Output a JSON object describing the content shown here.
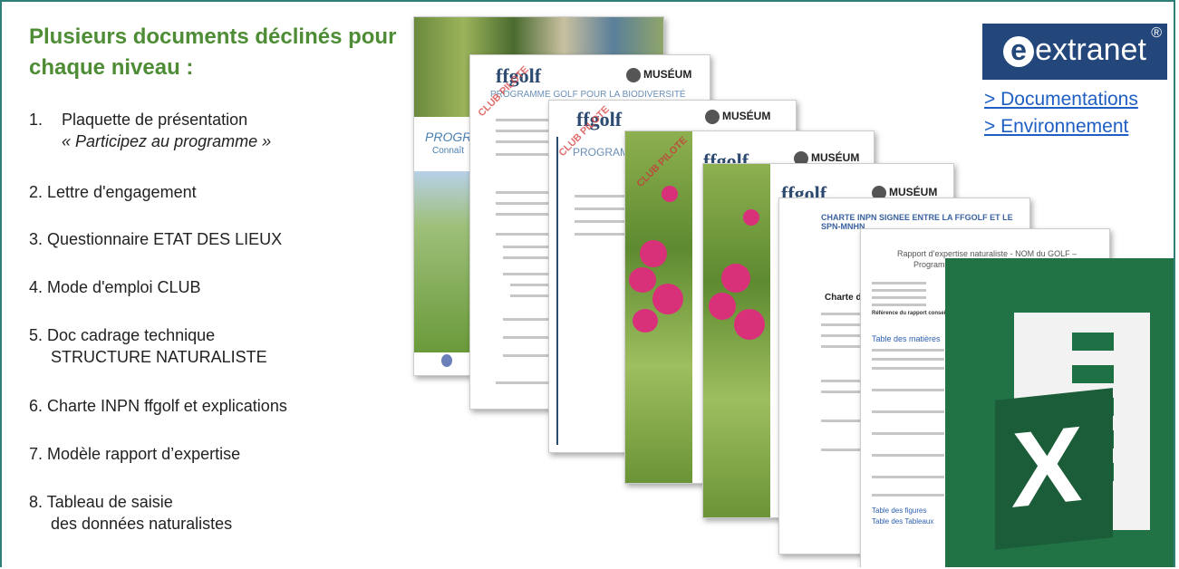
{
  "heading": "Plusieurs documents déclinés pour chaque niveau :",
  "items": [
    {
      "num": "1.",
      "line1": "Plaquette de présentation",
      "line2": "« Participez au programme »"
    },
    {
      "num": "2.",
      "line1": "Lettre d'engagement"
    },
    {
      "num": "3.",
      "line1": "Questionnaire ETAT DES LIEUX"
    },
    {
      "num": "4.",
      "line1": "Mode d'emploi CLUB"
    },
    {
      "num": "5.",
      "line1": "Doc cadrage technique",
      "line2": "STRUCTURE NATURALISTE"
    },
    {
      "num": "6.",
      "line1": "Charte INPN ffgolf et explications"
    },
    {
      "num": "7.",
      "line1": "Modèle rapport d’expertise"
    },
    {
      "num": "8.",
      "line1": "Tableau de saisie",
      "line2": "des données naturalistes"
    }
  ],
  "extranet": {
    "logo_text": "extranet",
    "reg_mark": "®",
    "links": [
      "> Documentations",
      "> Environnement"
    ]
  },
  "docs": {
    "ffgolf": "ffgolf",
    "museum": "MUSÉUM",
    "club_pilote": "CLUB PILOTE",
    "prog_golf": "PROGRAMME GOLF POUR LA BIODIVERSITÉ",
    "prog_short": "PROGRAMM",
    "prog_left": "PROGRA",
    "connais": "Connaît",
    "charte_title": "CHARTE INPN SIGNEE ENTRE LA FFGOLF ET LE SPN-MNHN",
    "rapport_title": "Rapport d’expertise naturaliste - NOM du GOLF –",
    "rapport_sub": "Programme golf pour la biodiversité",
    "table_matieres": "Table des matières",
    "table_figures": "Table des figures",
    "table_tableaux": "Table des Tableaux",
    "reference": "Référence du rapport conseillée :",
    "charte_side": "Charte d'utili"
  },
  "colors": {
    "heading": "#4e8d35",
    "frame": "#2f7e78",
    "extranet_bg": "#23477b",
    "link": "#1f5fc4",
    "excel": "#217346"
  }
}
